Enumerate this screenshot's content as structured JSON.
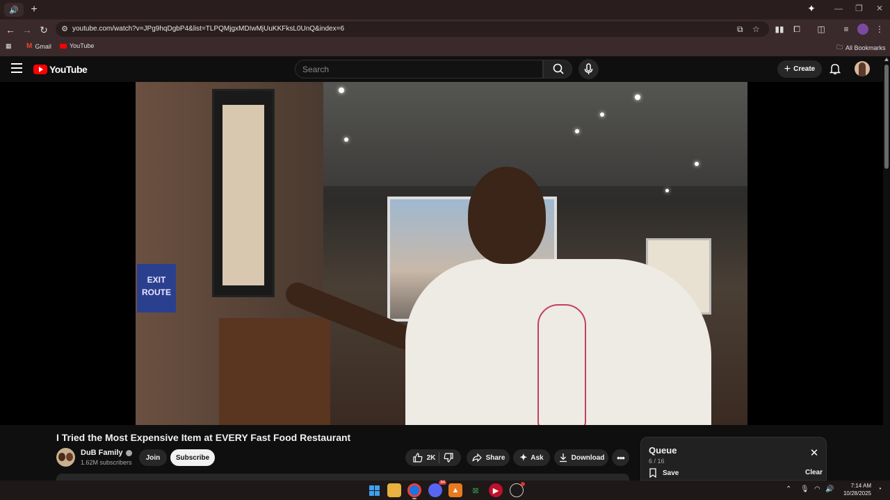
{
  "browser": {
    "tab_icon": "speaker-icon",
    "url": "youtube.com/watch?v=JPg9hqDgbP4&list=TLPQMjgxMDIwMjUuKKFksL0UnQ&index=6",
    "bookmarks": [
      {
        "label": "Gmail",
        "icon": "gmail-icon"
      },
      {
        "label": "YouTube",
        "icon": "youtube-icon"
      }
    ],
    "all_bookmarks_label": "All Bookmarks"
  },
  "youtube": {
    "logo_text": "YouTube",
    "search_placeholder": "Search",
    "create_label": "Create",
    "brand_color": "#ff0000"
  },
  "video": {
    "title": "I Tried the Most Expensive Item at EVERY Fast Food Restaurant",
    "exit_sign": "EXIT ROUTE"
  },
  "channel": {
    "name": "DuB Family",
    "subscribers": "1.62M subscribers",
    "join_label": "Join",
    "subscribe_label": "Subscribe"
  },
  "actions": {
    "likes": "2K",
    "share_label": "Share",
    "ask_label": "Ask",
    "download_label": "Download"
  },
  "queue": {
    "title": "Queue",
    "count": "6 / 16",
    "save_label": "Save",
    "clear_label": "Clear"
  },
  "taskbar": {
    "time": "7:14 AM",
    "date": "10/28/2025",
    "discord_badge": "94"
  }
}
